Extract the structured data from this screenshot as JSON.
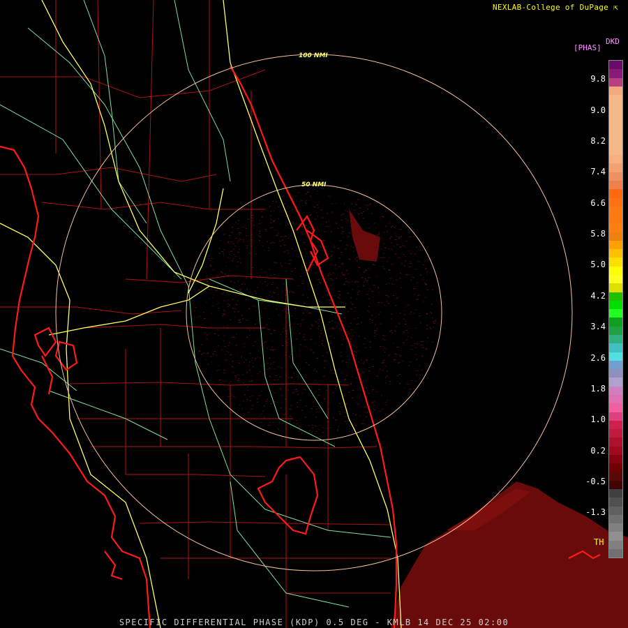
{
  "credit": "NEXLAB-College of DuPage",
  "credit_icon": "cursor-arrow-icon",
  "product_line": "SPECIFIC DIFFERENTIAL PHASE (KDP) 0.5 DEG - KMLB 14 DEC 25 02:00",
  "range_rings": [
    {
      "label": "100 NMI",
      "range_nmi": 100
    },
    {
      "label": "50 NMI",
      "range_nmi": 50
    }
  ],
  "colors": {
    "state_outline": "#ff1a1a",
    "county_lines": "#b01212",
    "highways": "#ffff66",
    "roads": "#7fe0a0",
    "range_rings": "#f5c09a",
    "echo": "#6a0b0b",
    "background": "#000000"
  },
  "legend": {
    "product": "DKD",
    "units": "[PHAS]",
    "ticks": [
      "9.8",
      "9.0",
      "8.2",
      "7.4",
      "6.6",
      "5.8",
      "5.0",
      "4.2",
      "3.4",
      "2.6",
      "1.8",
      "1.0",
      "0.2",
      "-0.5",
      "-1.3",
      "TH"
    ],
    "colors": [
      "#6a0a6a",
      "#8a1a7a",
      "#b84080",
      "#f4a880",
      "#f7b888",
      "#f7b888",
      "#f7b888",
      "#f7b888",
      "#f7b888",
      "#f7b888",
      "#f7b888",
      "#f8b080",
      "#f4a070",
      "#f09060",
      "#ee8050",
      "#ff6a10",
      "#ff7010",
      "#ff7a10",
      "#ff7810",
      "#ff8010",
      "#f08010",
      "#ffa000",
      "#ffc000",
      "#ffe000",
      "#ffff00",
      "#ffff20",
      "#e0e000",
      "#20c000",
      "#00e000",
      "#20ff20",
      "#10a020",
      "#20a040",
      "#30b080",
      "#40c0c0",
      "#50e0e0",
      "#70a0d0",
      "#9090c0",
      "#b0a0d0",
      "#d080c0",
      "#e070b0",
      "#f060a0",
      "#e04080",
      "#d02050",
      "#c01a40",
      "#b01030",
      "#a00820",
      "#880010",
      "#700000",
      "#580808",
      "#400404",
      "#404040",
      "#505050",
      "#606060",
      "#707070",
      "#808080",
      "#909090",
      "#808080",
      "#707070"
    ]
  }
}
